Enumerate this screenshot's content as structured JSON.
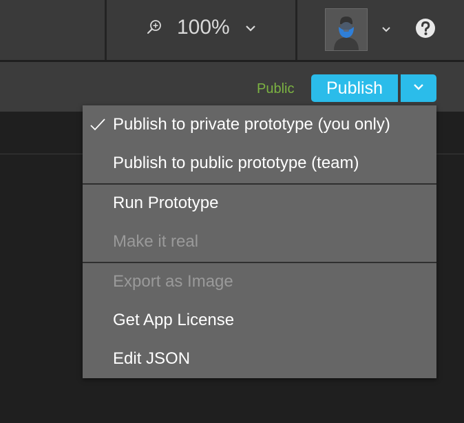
{
  "toolbar": {
    "zoom_value": "100%",
    "zoom_icon": "zoom-in-icon",
    "help_icon": "question-circle-icon"
  },
  "publish_bar": {
    "visibility_label": "Public",
    "publish_label": "Publish",
    "accent_color": "#2bbcea",
    "visibility_color": "#7cb342"
  },
  "menu": {
    "items": [
      {
        "label": "Publish to private prototype (you only)",
        "checked": true,
        "enabled": true
      },
      {
        "label": "Publish to public prototype (team)",
        "checked": false,
        "enabled": true
      },
      {
        "label": "Run Prototype",
        "checked": false,
        "enabled": true
      },
      {
        "label": "Make it real",
        "checked": false,
        "enabled": false
      },
      {
        "label": "Export as Image",
        "checked": false,
        "enabled": false
      },
      {
        "label": "Get App License",
        "checked": false,
        "enabled": true
      },
      {
        "label": "Edit JSON",
        "checked": false,
        "enabled": true
      }
    ]
  }
}
